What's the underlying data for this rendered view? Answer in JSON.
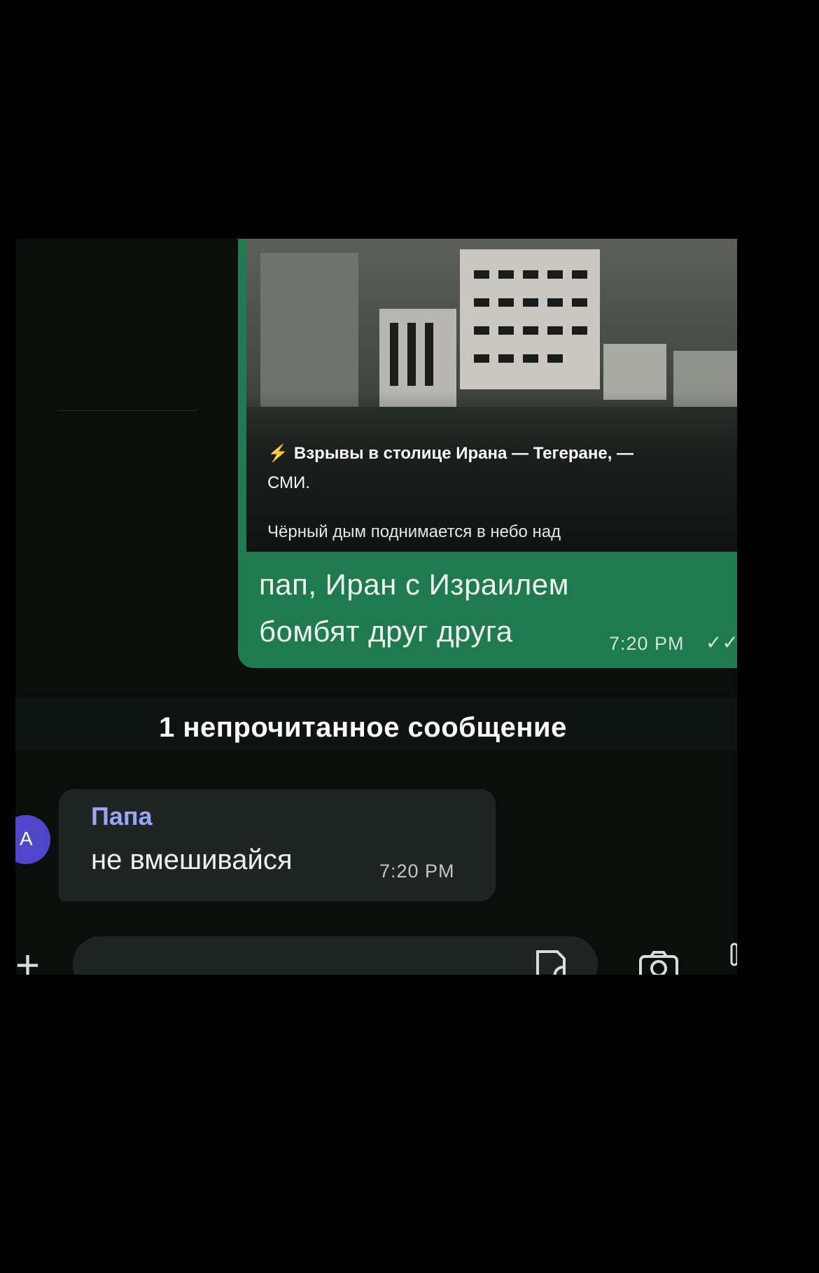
{
  "outgoing": {
    "preview": {
      "headline": "Взрывы в столице Ирана — Тегеране, —",
      "source": "СМИ.",
      "description": "Чёрный дым поднимается в небо над"
    },
    "text_line1": "пап, Иран с Израилем",
    "text_line2": "бомбят друг друга",
    "time": "7:20 PM",
    "status_icon": "double-check-icon"
  },
  "unread_divider": "1 непрочитанное сообщение",
  "incoming": {
    "avatar_letter": "A",
    "sender": "Папа",
    "text": "не вмешивайся",
    "time": "7:20 PM"
  },
  "composer": {
    "attach_icon": "plus-icon",
    "placeholder": "",
    "sticker_icon": "sticker-icon",
    "camera_icon": "camera-icon",
    "mic_icon": "mic-icon"
  },
  "colors": {
    "outgoing_bubble": "#1f7a4f",
    "incoming_bubble": "#1f2523",
    "avatar": "#4f46c9",
    "sender_name": "#9aa6f5",
    "background": "#0b0f0c"
  }
}
